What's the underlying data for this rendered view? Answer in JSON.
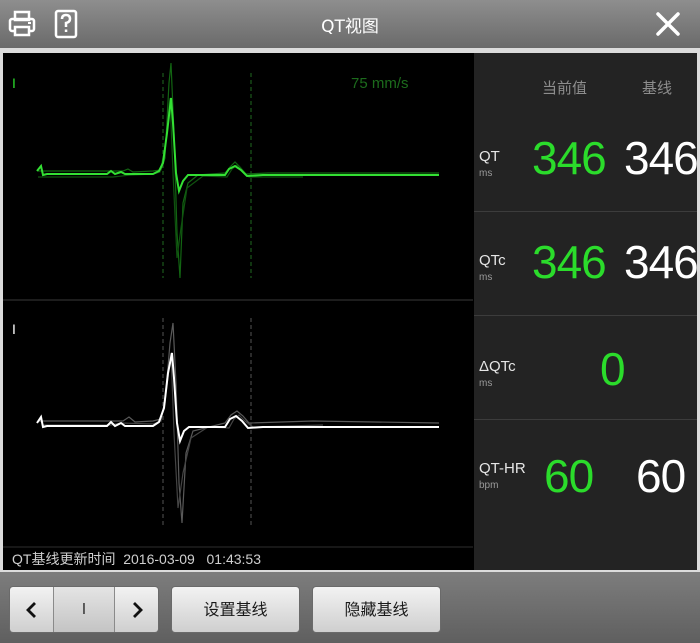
{
  "window": {
    "title": "QT视图"
  },
  "icons": {
    "print": "printer-icon",
    "help": "help-icon",
    "close": "close-icon"
  },
  "waveform": {
    "speed": "75 mm/s",
    "top_lead": "I",
    "bottom_lead": "I",
    "colors": {
      "current": "#2bdc2b",
      "baseline": "#ffffff"
    }
  },
  "status": {
    "text": "QT基线更新时间  2016-03-09   01:43:53"
  },
  "panel": {
    "header_current": "当前值",
    "header_baseline": "基线",
    "rows": [
      {
        "name": "QT",
        "unit": "ms",
        "current": "346",
        "baseline": "346"
      },
      {
        "name": "QTc",
        "unit": "ms",
        "current": "346",
        "baseline": "346"
      },
      {
        "name": "ΔQTc",
        "unit": "ms",
        "current": "0",
        "baseline": ""
      },
      {
        "name": "QT-HR",
        "unit": "bpm",
        "current": "60",
        "baseline": "60"
      }
    ]
  },
  "bottom": {
    "lead_value": "I",
    "set_baseline": "设置基线",
    "hide_baseline": "隐藏基线"
  }
}
